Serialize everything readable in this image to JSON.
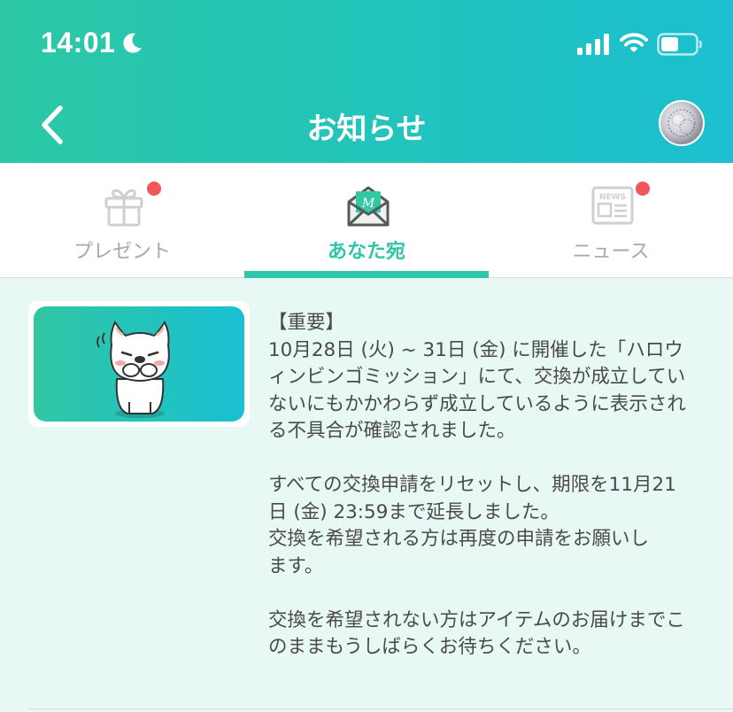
{
  "status_bar": {
    "time": "14:01",
    "icons": [
      "moon-icon",
      "signal-icon",
      "wifi-icon",
      "battery-icon"
    ]
  },
  "header": {
    "title": "お知らせ",
    "back_icon": "chevron-left-icon",
    "avatar": "avatar"
  },
  "tabs": [
    {
      "label": "プレゼント",
      "icon": "gift-icon",
      "has_badge": true,
      "active": false
    },
    {
      "label": "あなた宛",
      "icon": "envelope-icon",
      "has_badge": false,
      "active": true
    },
    {
      "label": "ニュース",
      "icon": "newspaper-icon",
      "has_badge": true,
      "active": false
    }
  ],
  "notice": {
    "thumbnail": "bulldog-bowing-illustration",
    "paragraphs": [
      {
        "lines": [
          "【重要】",
          "10月28日 (火) ~ 31日 (金) に開催した「ハロウ",
          "ィンビンゴミッション」にて、交換が成立してい",
          "ないにもかかわらず成立しているように表示され",
          "る不具合が確認されました。"
        ]
      },
      {
        "lines": [
          "すべての交換申請をリセットし、期限を11月21",
          "日 (金) 23:59まで延長しました。",
          "交換を希望される方は再度の申請をお願いし",
          "ます。"
        ]
      },
      {
        "lines": [
          "交換を希望されない方はアイテムのお届けまでこ",
          "のままもうしばらくお待ちください。"
        ]
      }
    ]
  },
  "colors": {
    "accent": "#2fc6a9",
    "header_gradient_start": "#2cc8a6",
    "header_gradient_end": "#1bbfd0",
    "badge": "#f2555a",
    "background": "#e8f8f4"
  }
}
